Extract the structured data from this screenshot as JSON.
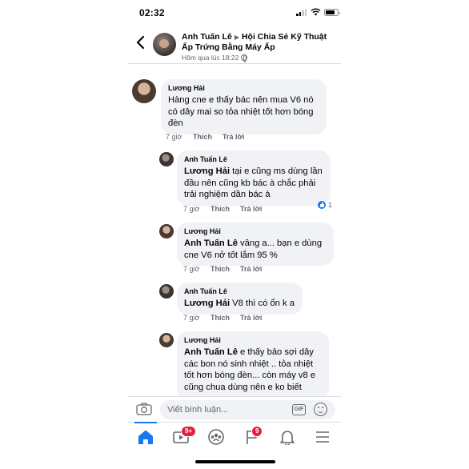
{
  "status_bar": {
    "time": "02:32"
  },
  "header": {
    "author": "Anh Tuấn Lê",
    "group": "Hội Chia Sẻ Kỹ Thuật Ấp Trứng Bằng Máy Ấp",
    "timestamp": "Hôm qua lúc 18:22"
  },
  "comments": [
    {
      "author": "Lương Hải",
      "tag": "",
      "text": "Hàng cne e thấy bác nên mua V6 nó có dây mai so tỏa nhiệt tốt hơn bóng đèn",
      "time": "7 giờ",
      "like": "Thích",
      "reply": "Trả lời",
      "reactions": ""
    },
    {
      "author": "Anh Tuấn Lê",
      "tag": "Lương Hải",
      "text": " tại e cũng ms dùng lần đầu nên cũng kb bác à chắc phải trải nghiệm dần bác à",
      "time": "7 giờ",
      "like": "Thích",
      "reply": "Trả lời",
      "reactions": "1"
    },
    {
      "author": "Lương Hải",
      "tag": "Anh Tuấn Lê",
      "text": "  vâng a... bạn e dùng cne V6 nở tốt lắm 95 %",
      "time": "7 giờ",
      "like": "Thích",
      "reply": "Trả lời",
      "reactions": ""
    },
    {
      "author": "Anh Tuấn Lê",
      "tag": "Lương Hải",
      "text": " V8 thì có ổn k a",
      "time": "7 giờ",
      "like": "Thích",
      "reply": "Trả lời",
      "reactions": ""
    },
    {
      "author": "Lương Hải",
      "tag": "Anh Tuấn Lê",
      "text": "  e thấy bảo sợi dây các bon nó sinh nhiệt .. tỏa nhiệt tốt hơn bóng đèn... còn máy v8 e cũng chua dùng nên e ko biết",
      "time": "",
      "like": "",
      "reply": "",
      "reactions": ""
    }
  ],
  "composer": {
    "placeholder": "Viết bình luận...",
    "gif_label": "GIF"
  },
  "tabbar": {
    "items": [
      {
        "icon": "home-icon",
        "badge": ""
      },
      {
        "icon": "video-icon",
        "badge": "9+"
      },
      {
        "icon": "groups-icon",
        "badge": ""
      },
      {
        "icon": "flag-icon",
        "badge": "9"
      },
      {
        "icon": "bell-icon",
        "badge": ""
      },
      {
        "icon": "menu-icon",
        "badge": ""
      }
    ]
  },
  "colors": {
    "accent": "#1877f2",
    "badge": "#e41e3f",
    "bubble": "#f0f2f5",
    "secondary_text": "#65676b"
  }
}
